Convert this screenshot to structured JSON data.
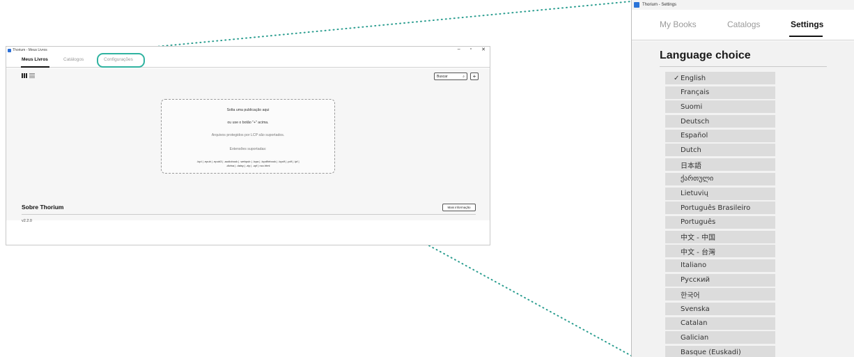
{
  "small_window": {
    "title": "Thorium - Meus Livros",
    "controls": {
      "minimize": "–",
      "maximize": "▫",
      "close": "✕"
    },
    "tabs": [
      {
        "label": "Meus Livros",
        "active": true
      },
      {
        "label": "Catálogos",
        "active": false
      },
      {
        "label": "Configurações",
        "active": false
      }
    ],
    "toolbar": {
      "search_label": "Buscar",
      "add_label": "+"
    },
    "dropzone": {
      "line1": "Solta uma publicação aqui",
      "line2": "ou use o botão \"+\" acima.",
      "line3": "Arquivos protegidos por LCP são suportados.",
      "line4": "Extensões suportadas:",
      "line5": ".lcpl | .epub | .epub3 | .audiobook | .webpub | .lcpa | .lcpdf/ebook | .lcpdf | .pdf | .lpf |",
      "line6": ".divina | .daisy | .zip | .opf | ncc.html"
    },
    "about": {
      "title": "Sobre Thorium",
      "more_button": "Mais informação",
      "version": "v2.2.0"
    }
  },
  "large_window": {
    "title": "Thorium - Settings",
    "tabs": [
      {
        "label": "My Books",
        "active": false
      },
      {
        "label": "Catalogs",
        "active": false
      },
      {
        "label": "Settings",
        "active": true
      }
    ],
    "heading": "Language choice",
    "selected_mark": "✓",
    "languages": [
      {
        "label": "English",
        "selected": true
      },
      {
        "label": "Français",
        "selected": false
      },
      {
        "label": "Suomi",
        "selected": false
      },
      {
        "label": "Deutsch",
        "selected": false
      },
      {
        "label": "Español",
        "selected": false
      },
      {
        "label": "Dutch",
        "selected": false
      },
      {
        "label": "日本語",
        "selected": false
      },
      {
        "label": "ქართული",
        "selected": false
      },
      {
        "label": "Lietuvių",
        "selected": false
      },
      {
        "label": "Português Brasileiro",
        "selected": false
      },
      {
        "label": "Português",
        "selected": false
      },
      {
        "label": "中文 - 中国",
        "selected": false
      },
      {
        "label": "中文 - 台灣",
        "selected": false
      },
      {
        "label": "Italiano",
        "selected": false
      },
      {
        "label": "Русский",
        "selected": false
      },
      {
        "label": "한국어",
        "selected": false
      },
      {
        "label": "Svenska",
        "selected": false
      },
      {
        "label": "Catalan",
        "selected": false
      },
      {
        "label": "Galician",
        "selected": false
      },
      {
        "label": "Basque (Euskadi)",
        "selected": false
      }
    ]
  },
  "colors": {
    "highlight": "#2fb3a0",
    "leader_dots": "#2a9d8f",
    "app_icon": "#2b74d8"
  }
}
